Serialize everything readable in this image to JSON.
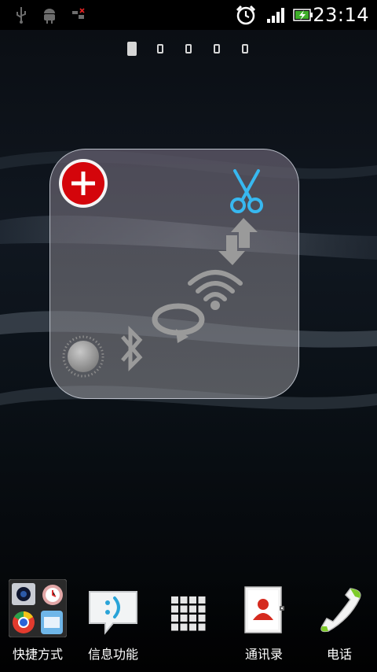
{
  "status_bar": {
    "time": "23:14",
    "icons": [
      "usb-icon",
      "android-debug-icon",
      "no-sim-icon",
      "alarm-clock-icon",
      "signal-strength-icon",
      "battery-charging-icon"
    ]
  },
  "home_pages": {
    "count": 5,
    "active_index": 0
  },
  "widget": {
    "type": "quick-settings-toggles",
    "icons": [
      "add-icon",
      "scissors-icon",
      "data-transfer-icon",
      "wifi-icon",
      "auto-rotate-icon",
      "bluetooth-icon",
      "brightness-icon"
    ],
    "colors": {
      "add": "#d4050b",
      "scissors": "#37b8f0",
      "inactive": "#9a9a9a"
    }
  },
  "dock": {
    "items": [
      {
        "label": "快捷方式",
        "icon": "shortcut-folder-icon"
      },
      {
        "label": "信息功能",
        "icon": "messaging-icon"
      },
      {
        "label": "",
        "icon": "app-drawer-grid-icon"
      },
      {
        "label": "通讯录",
        "icon": "contacts-icon"
      },
      {
        "label": "电话",
        "icon": "phone-icon"
      }
    ]
  }
}
